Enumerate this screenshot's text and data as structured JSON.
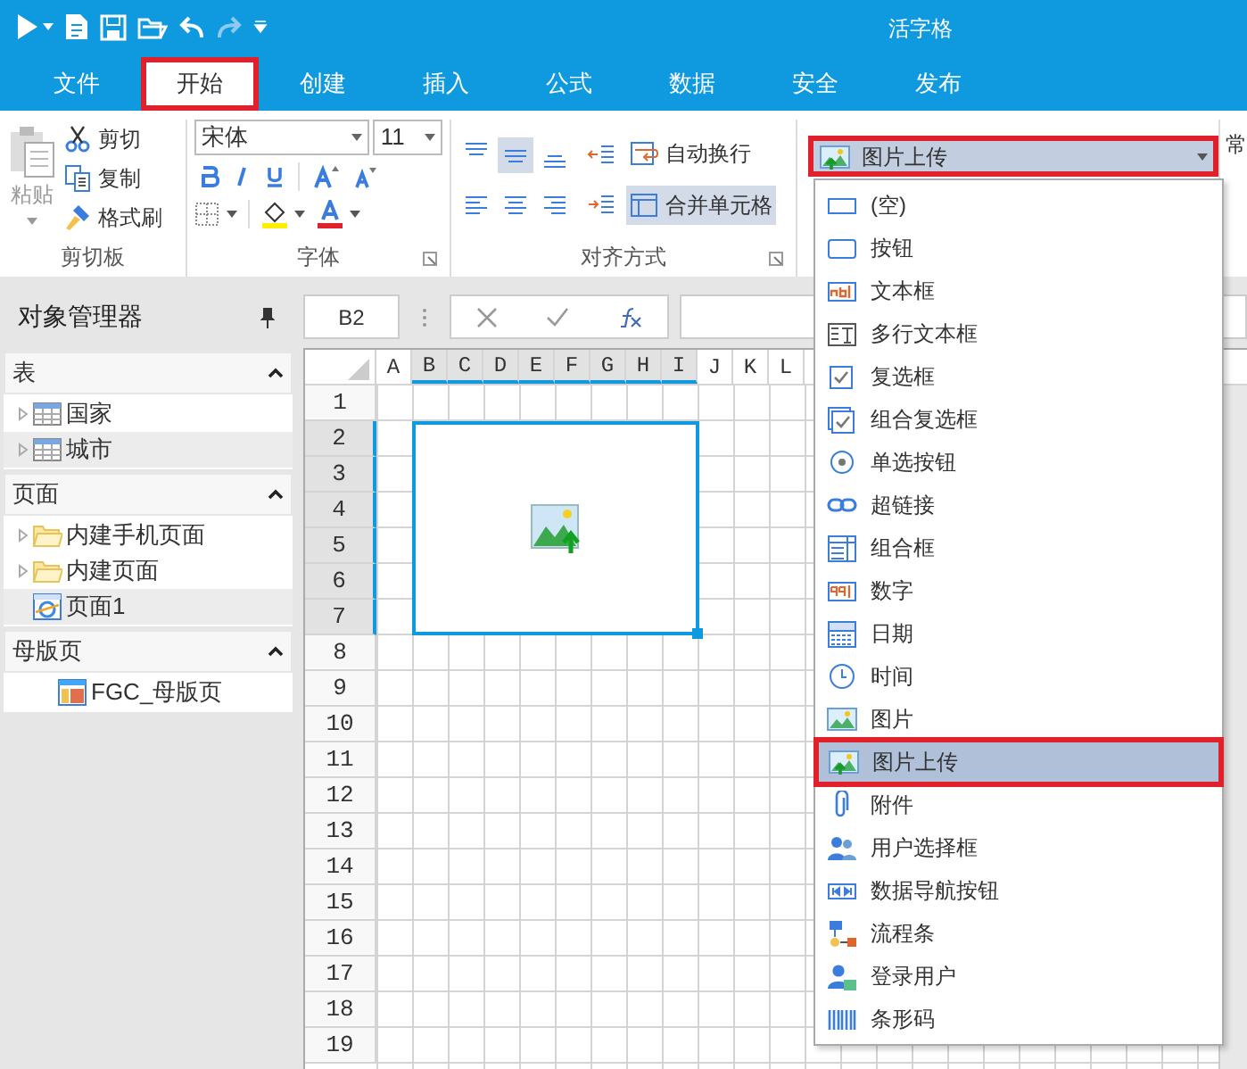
{
  "title_bar": {
    "title": "活字格"
  },
  "tabs": [
    {
      "label": "文件",
      "selected": false
    },
    {
      "label": "开始",
      "selected": true
    },
    {
      "label": "创建",
      "selected": false
    },
    {
      "label": "插入",
      "selected": false
    },
    {
      "label": "公式",
      "selected": false
    },
    {
      "label": "数据",
      "selected": false
    },
    {
      "label": "安全",
      "selected": false
    },
    {
      "label": "发布",
      "selected": false
    }
  ],
  "ribbon": {
    "clipboard": {
      "paste": "粘贴",
      "items": [
        {
          "kind": "cut",
          "label": "剪切"
        },
        {
          "kind": "copy",
          "label": "复制"
        },
        {
          "kind": "painter",
          "label": "格式刷"
        }
      ],
      "group_label": "剪切板"
    },
    "font": {
      "font_name": "宋体",
      "font_size": "11",
      "group_label": "字体"
    },
    "alignment": {
      "buttons": [
        {
          "kind": "top",
          "selected": false
        },
        {
          "kind": "middle",
          "selected": true
        },
        {
          "kind": "bottom",
          "selected": false
        },
        {
          "kind": "left",
          "selected": false
        },
        {
          "kind": "center",
          "selected": false
        },
        {
          "kind": "right",
          "selected": false
        }
      ],
      "wrap_text": {
        "label": "自动换行",
        "on": false
      },
      "merge_cells": {
        "label": "合并单元格",
        "on": true
      },
      "group_label": "对齐方式"
    },
    "cell_type": {
      "value": "图片上传"
    },
    "next_group_label": "常"
  },
  "object_manager": {
    "title": "对象管理器",
    "sections": [
      {
        "title": "表",
        "expanded": true,
        "items": [
          {
            "kind": "table",
            "label": "国家",
            "selected": false
          },
          {
            "kind": "table",
            "label": "城市",
            "selected": true
          }
        ]
      },
      {
        "title": "页面",
        "expanded": true,
        "items": [
          {
            "kind": "folder",
            "label": "内建手机页面",
            "selected": false
          },
          {
            "kind": "folder",
            "label": "内建页面",
            "selected": false
          },
          {
            "kind": "page",
            "label": "页面1",
            "selected": true
          }
        ]
      },
      {
        "title": "母版页",
        "expanded": true,
        "items": [
          {
            "kind": "master",
            "label": "FGC_母版页",
            "selected": false
          }
        ]
      }
    ]
  },
  "formula_bar": {
    "name_box": "B2"
  },
  "sheet": {
    "columns": [
      {
        "label": "A",
        "selected": false
      },
      {
        "label": "B",
        "selected": true
      },
      {
        "label": "C",
        "selected": true
      },
      {
        "label": "D",
        "selected": true
      },
      {
        "label": "E",
        "selected": true
      },
      {
        "label": "F",
        "selected": true
      },
      {
        "label": "G",
        "selected": true
      },
      {
        "label": "H",
        "selected": true
      },
      {
        "label": "I",
        "selected": true
      },
      {
        "label": "J",
        "selected": false
      },
      {
        "label": "K",
        "selected": false
      },
      {
        "label": "L",
        "selected": false
      }
    ],
    "rows": [
      {
        "label": "1",
        "selected": false
      },
      {
        "label": "2",
        "selected": true
      },
      {
        "label": "3",
        "selected": true
      },
      {
        "label": "4",
        "selected": true
      },
      {
        "label": "5",
        "selected": true
      },
      {
        "label": "6",
        "selected": true
      },
      {
        "label": "7",
        "selected": true
      },
      {
        "label": "8",
        "selected": false
      },
      {
        "label": "9",
        "selected": false
      },
      {
        "label": "10",
        "selected": false
      },
      {
        "label": "11",
        "selected": false
      },
      {
        "label": "12",
        "selected": false
      },
      {
        "label": "13",
        "selected": false
      },
      {
        "label": "14",
        "selected": false
      },
      {
        "label": "15",
        "selected": false
      },
      {
        "label": "16",
        "selected": false
      },
      {
        "label": "17",
        "selected": false
      },
      {
        "label": "18",
        "selected": false
      },
      {
        "label": "19",
        "selected": false
      }
    ]
  },
  "cell_type_menu": {
    "items": [
      {
        "kind": "empty",
        "label": "(空)",
        "selected": false
      },
      {
        "kind": "button",
        "label": "按钮",
        "selected": false
      },
      {
        "kind": "textbox",
        "label": "文本框",
        "selected": false
      },
      {
        "kind": "multiline",
        "label": "多行文本框",
        "selected": false
      },
      {
        "kind": "checkbox",
        "label": "复选框",
        "selected": false
      },
      {
        "kind": "checklist",
        "label": "组合复选框",
        "selected": false
      },
      {
        "kind": "radio",
        "label": "单选按钮",
        "selected": false
      },
      {
        "kind": "link",
        "label": "超链接",
        "selected": false
      },
      {
        "kind": "combo",
        "label": "组合框",
        "selected": false
      },
      {
        "kind": "number",
        "label": "数字",
        "selected": false
      },
      {
        "kind": "date",
        "label": "日期",
        "selected": false
      },
      {
        "kind": "time",
        "label": "时间",
        "selected": false
      },
      {
        "kind": "image",
        "label": "图片",
        "selected": false
      },
      {
        "kind": "upload",
        "label": "图片上传",
        "selected": true
      },
      {
        "kind": "attachment",
        "label": "附件",
        "selected": false
      },
      {
        "kind": "users",
        "label": "用户选择框",
        "selected": false
      },
      {
        "kind": "nav",
        "label": "数据导航按钮",
        "selected": false
      },
      {
        "kind": "flow",
        "label": "流程条",
        "selected": false
      },
      {
        "kind": "user",
        "label": "登录用户",
        "selected": false
      },
      {
        "kind": "barcode",
        "label": "条形码",
        "selected": false
      }
    ]
  }
}
